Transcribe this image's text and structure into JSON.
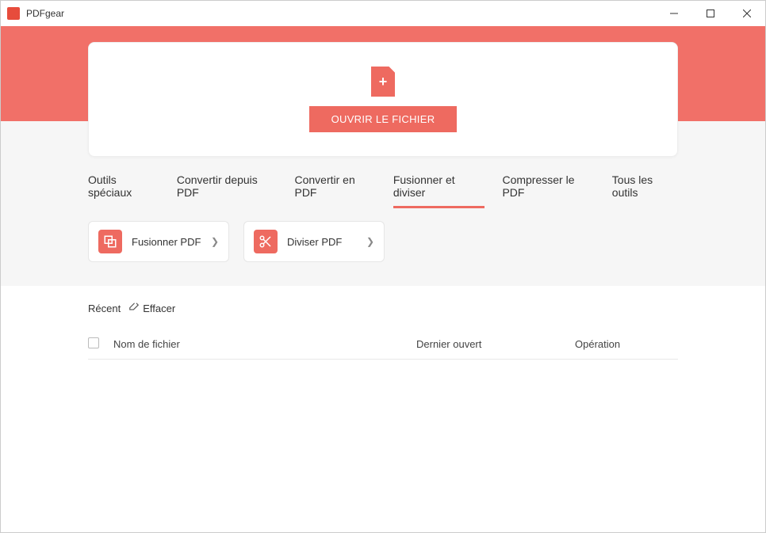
{
  "window": {
    "title": "PDFgear"
  },
  "hero": {
    "open_button": "OUVRIR LE FICHIER"
  },
  "tabs": {
    "items": [
      {
        "label": "Outils spéciaux"
      },
      {
        "label": "Convertir depuis PDF"
      },
      {
        "label": "Convertir en PDF"
      },
      {
        "label": "Fusionner et diviser"
      },
      {
        "label": "Compresser le PDF"
      },
      {
        "label": "Tous les outils"
      }
    ],
    "active_index": 3
  },
  "tools": [
    {
      "label": "Fusionner PDF",
      "icon": "merge"
    },
    {
      "label": "Diviser PDF",
      "icon": "split"
    }
  ],
  "recent": {
    "title": "Récent",
    "clear_label": "Effacer",
    "columns": {
      "name": "Nom de fichier",
      "opened": "Dernier ouvert",
      "operation": "Opération"
    },
    "rows": []
  },
  "colors": {
    "accent": "#ee6a60"
  }
}
